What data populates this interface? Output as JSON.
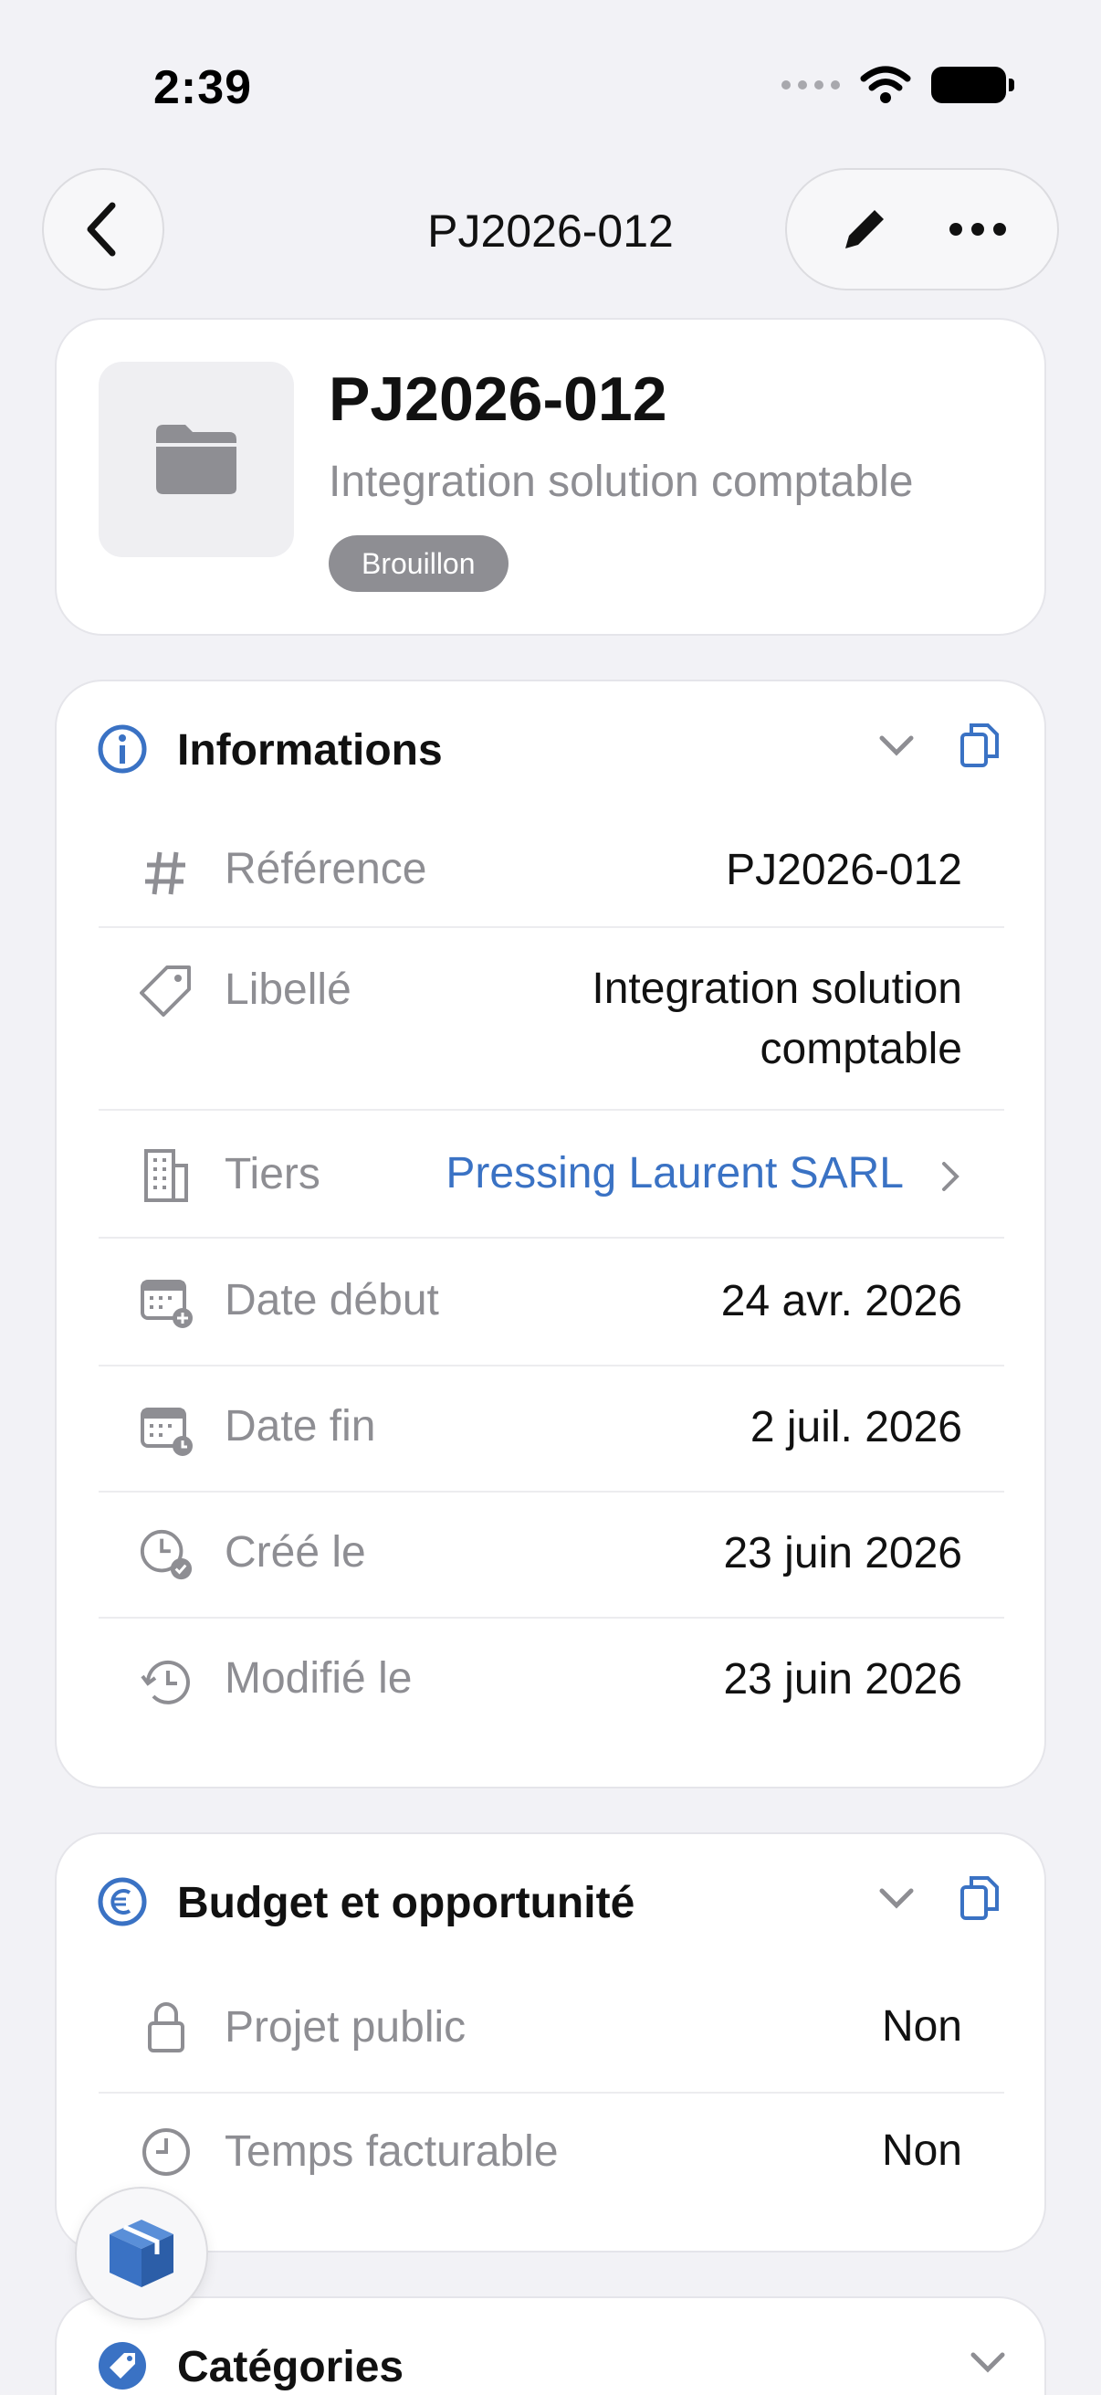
{
  "status_bar": {
    "time": "2:39"
  },
  "nav": {
    "title": "PJ2026-012"
  },
  "project": {
    "reference": "PJ2026-012",
    "label": "Integration solution comptable",
    "status": "Brouillon"
  },
  "informations": {
    "title": "Informations",
    "rows": [
      {
        "label": "Référence",
        "value": "PJ2026-012",
        "icon": "hash-icon"
      },
      {
        "label": "Libellé",
        "value_line1": "Integration solution",
        "value_line2": "comptable",
        "icon": "tag-icon"
      },
      {
        "label": "Tiers",
        "value": "Pressing Laurent SARL",
        "icon": "building-icon"
      },
      {
        "label": "Date début",
        "value": "24 avr. 2026",
        "icon": "calendar-start-icon"
      },
      {
        "label": "Date fin",
        "value": "2 juil. 2026",
        "icon": "calendar-end-icon"
      },
      {
        "label": "Créé le",
        "value": "23 juin 2026",
        "icon": "clock-check-icon"
      },
      {
        "label": "Modifié le",
        "value": "23 juin 2026",
        "icon": "history-icon"
      }
    ]
  },
  "budget": {
    "title": "Budget et opportunité",
    "rows": [
      {
        "label": "Projet public",
        "value": "Non",
        "icon": "lock-icon"
      },
      {
        "label": "Temps facturable",
        "value": "Non",
        "icon": "clock-icon"
      }
    ]
  },
  "categories": {
    "title": "Catégories"
  },
  "colors": {
    "accent": "#3a72c4",
    "muted": "#8e8e93",
    "badge": "#8e8e93",
    "background": "#f2f2f6"
  }
}
